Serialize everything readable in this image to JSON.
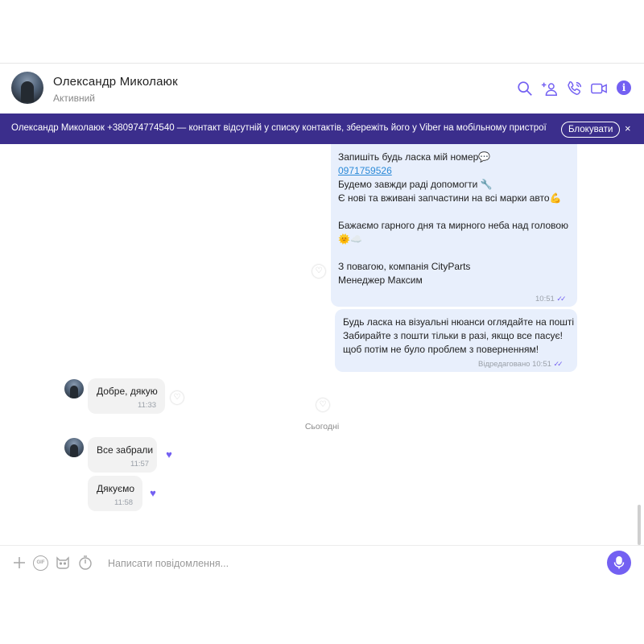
{
  "header": {
    "contact_name": "Олександр Миколаюк",
    "status": "Активний",
    "icons": [
      "search-icon",
      "add-participant-icon",
      "call-icon",
      "video-call-icon",
      "info-icon"
    ],
    "info_glyph": "i"
  },
  "banner": {
    "text": "Олександр Миколаюк +380974774540 — контакт відсутній у списку контактів, збережіть його у Viber на мобільному пристрої",
    "block_label": "Блокувати",
    "close_glyph": "×"
  },
  "messages": {
    "m1": {
      "lines": [
        "Запишіть будь ласка мій номер💬",
        "0971759526",
        "Будемо завжди раді допомогти 🔧",
        "Є нові та вживані запчастини на всі марки авто💪",
        "",
        "Бажаємо гарного дня та мирного неба над головою",
        "🌞☁️",
        "",
        "З повагою, компанія CityParts",
        "Менеджер Максим"
      ],
      "time": "10:51"
    },
    "m2": {
      "lines": [
        "Будь ласка на візуальні нюанси оглядайте на пошті",
        "Забирайте з пошти тільки в разі, якщо все пасує!",
        "щоб потім не було проблем з поверненням!"
      ],
      "time": "Відредаговано 10:51"
    },
    "m3": {
      "text": "Добре, дякую",
      "time": "11:33"
    },
    "date_separator": "Сьогодні",
    "m4": {
      "text": "Все забрали",
      "time": "11:57"
    },
    "m5": {
      "text": "Дякуємо",
      "time": "11:58"
    }
  },
  "input": {
    "placeholder": "Написати повідомлення...",
    "gif_label": "GIF"
  },
  "colors": {
    "accent": "#7360f2",
    "banner": "#3b2e8c",
    "outgoing_bubble": "#e8effc",
    "incoming_bubble": "#f2f2f2",
    "link": "#2b8ad8"
  }
}
